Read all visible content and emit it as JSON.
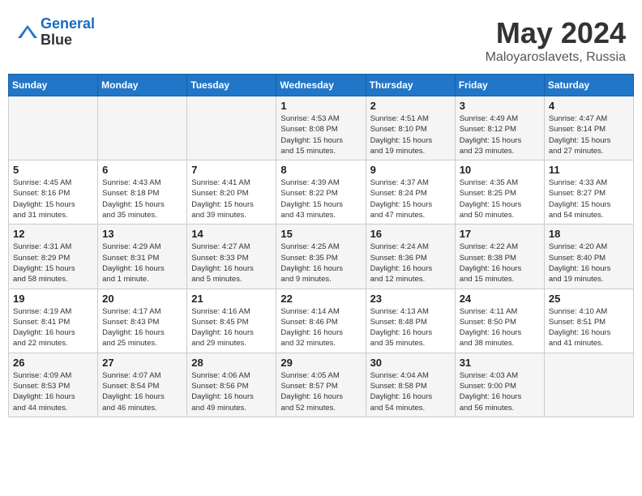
{
  "header": {
    "logo_line1": "General",
    "logo_line2": "Blue",
    "month": "May 2024",
    "location": "Maloyaroslavets, Russia"
  },
  "days_of_week": [
    "Sunday",
    "Monday",
    "Tuesday",
    "Wednesday",
    "Thursday",
    "Friday",
    "Saturday"
  ],
  "weeks": [
    [
      {
        "day": "",
        "info": ""
      },
      {
        "day": "",
        "info": ""
      },
      {
        "day": "",
        "info": ""
      },
      {
        "day": "1",
        "info": "Sunrise: 4:53 AM\nSunset: 8:08 PM\nDaylight: 15 hours\nand 15 minutes."
      },
      {
        "day": "2",
        "info": "Sunrise: 4:51 AM\nSunset: 8:10 PM\nDaylight: 15 hours\nand 19 minutes."
      },
      {
        "day": "3",
        "info": "Sunrise: 4:49 AM\nSunset: 8:12 PM\nDaylight: 15 hours\nand 23 minutes."
      },
      {
        "day": "4",
        "info": "Sunrise: 4:47 AM\nSunset: 8:14 PM\nDaylight: 15 hours\nand 27 minutes."
      }
    ],
    [
      {
        "day": "5",
        "info": "Sunrise: 4:45 AM\nSunset: 8:16 PM\nDaylight: 15 hours\nand 31 minutes."
      },
      {
        "day": "6",
        "info": "Sunrise: 4:43 AM\nSunset: 8:18 PM\nDaylight: 15 hours\nand 35 minutes."
      },
      {
        "day": "7",
        "info": "Sunrise: 4:41 AM\nSunset: 8:20 PM\nDaylight: 15 hours\nand 39 minutes."
      },
      {
        "day": "8",
        "info": "Sunrise: 4:39 AM\nSunset: 8:22 PM\nDaylight: 15 hours\nand 43 minutes."
      },
      {
        "day": "9",
        "info": "Sunrise: 4:37 AM\nSunset: 8:24 PM\nDaylight: 15 hours\nand 47 minutes."
      },
      {
        "day": "10",
        "info": "Sunrise: 4:35 AM\nSunset: 8:25 PM\nDaylight: 15 hours\nand 50 minutes."
      },
      {
        "day": "11",
        "info": "Sunrise: 4:33 AM\nSunset: 8:27 PM\nDaylight: 15 hours\nand 54 minutes."
      }
    ],
    [
      {
        "day": "12",
        "info": "Sunrise: 4:31 AM\nSunset: 8:29 PM\nDaylight: 15 hours\nand 58 minutes."
      },
      {
        "day": "13",
        "info": "Sunrise: 4:29 AM\nSunset: 8:31 PM\nDaylight: 16 hours\nand 1 minute."
      },
      {
        "day": "14",
        "info": "Sunrise: 4:27 AM\nSunset: 8:33 PM\nDaylight: 16 hours\nand 5 minutes."
      },
      {
        "day": "15",
        "info": "Sunrise: 4:25 AM\nSunset: 8:35 PM\nDaylight: 16 hours\nand 9 minutes."
      },
      {
        "day": "16",
        "info": "Sunrise: 4:24 AM\nSunset: 8:36 PM\nDaylight: 16 hours\nand 12 minutes."
      },
      {
        "day": "17",
        "info": "Sunrise: 4:22 AM\nSunset: 8:38 PM\nDaylight: 16 hours\nand 15 minutes."
      },
      {
        "day": "18",
        "info": "Sunrise: 4:20 AM\nSunset: 8:40 PM\nDaylight: 16 hours\nand 19 minutes."
      }
    ],
    [
      {
        "day": "19",
        "info": "Sunrise: 4:19 AM\nSunset: 8:41 PM\nDaylight: 16 hours\nand 22 minutes."
      },
      {
        "day": "20",
        "info": "Sunrise: 4:17 AM\nSunset: 8:43 PM\nDaylight: 16 hours\nand 25 minutes."
      },
      {
        "day": "21",
        "info": "Sunrise: 4:16 AM\nSunset: 8:45 PM\nDaylight: 16 hours\nand 29 minutes."
      },
      {
        "day": "22",
        "info": "Sunrise: 4:14 AM\nSunset: 8:46 PM\nDaylight: 16 hours\nand 32 minutes."
      },
      {
        "day": "23",
        "info": "Sunrise: 4:13 AM\nSunset: 8:48 PM\nDaylight: 16 hours\nand 35 minutes."
      },
      {
        "day": "24",
        "info": "Sunrise: 4:11 AM\nSunset: 8:50 PM\nDaylight: 16 hours\nand 38 minutes."
      },
      {
        "day": "25",
        "info": "Sunrise: 4:10 AM\nSunset: 8:51 PM\nDaylight: 16 hours\nand 41 minutes."
      }
    ],
    [
      {
        "day": "26",
        "info": "Sunrise: 4:09 AM\nSunset: 8:53 PM\nDaylight: 16 hours\nand 44 minutes."
      },
      {
        "day": "27",
        "info": "Sunrise: 4:07 AM\nSunset: 8:54 PM\nDaylight: 16 hours\nand 46 minutes."
      },
      {
        "day": "28",
        "info": "Sunrise: 4:06 AM\nSunset: 8:56 PM\nDaylight: 16 hours\nand 49 minutes."
      },
      {
        "day": "29",
        "info": "Sunrise: 4:05 AM\nSunset: 8:57 PM\nDaylight: 16 hours\nand 52 minutes."
      },
      {
        "day": "30",
        "info": "Sunrise: 4:04 AM\nSunset: 8:58 PM\nDaylight: 16 hours\nand 54 minutes."
      },
      {
        "day": "31",
        "info": "Sunrise: 4:03 AM\nSunset: 9:00 PM\nDaylight: 16 hours\nand 56 minutes."
      },
      {
        "day": "",
        "info": ""
      }
    ]
  ]
}
